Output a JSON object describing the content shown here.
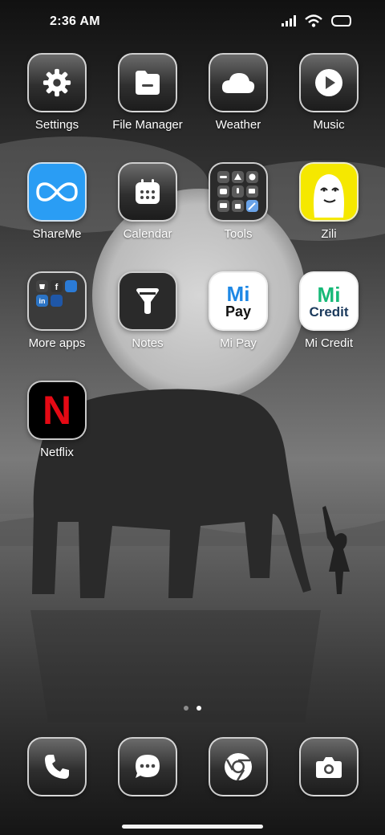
{
  "status_bar": {
    "time": "2:36 AM",
    "icons": [
      "signal-icon",
      "wifi-icon",
      "battery-icon"
    ]
  },
  "apps": [
    {
      "label": "Settings",
      "icon": "gear-icon"
    },
    {
      "label": "File Manager",
      "icon": "folder-icon"
    },
    {
      "label": "Weather",
      "icon": "cloud-icon"
    },
    {
      "label": "Music",
      "icon": "play-icon"
    },
    {
      "label": "ShareMe",
      "icon": "infinity-icon",
      "color": "#2196f3"
    },
    {
      "label": "Calendar",
      "icon": "calendar-icon"
    },
    {
      "label": "Tools",
      "icon": "tools-folder-icon"
    },
    {
      "label": "Zili",
      "icon": "zili-face-icon",
      "color": "#f5e800"
    },
    {
      "label": "More apps",
      "icon": "apps-folder-icon"
    },
    {
      "label": "Notes",
      "icon": "notes-icon"
    },
    {
      "label": "Mi Pay",
      "icon": "mi-pay-icon",
      "logo_text": [
        "Mi",
        "Pay"
      ],
      "color": "#1e88e5"
    },
    {
      "label": "Mi Credit",
      "icon": "mi-credit-icon",
      "logo_text": [
        "Mi",
        "Credit"
      ],
      "color": "#17b978"
    },
    {
      "label": "Netflix",
      "icon": "netflix-icon",
      "logo_text": [
        "N"
      ],
      "color": "#e50914"
    }
  ],
  "folder_previews": {
    "more_apps": [
      "shopping-icon",
      "facebook-icon",
      "prime-video-icon",
      "linkedin-icon",
      "booking-icon"
    ]
  },
  "pager": {
    "pages": 2,
    "active": 2
  },
  "dock": [
    {
      "label": "Phone",
      "icon": "phone-icon"
    },
    {
      "label": "Messages",
      "icon": "message-icon"
    },
    {
      "label": "Chrome",
      "icon": "chrome-icon"
    },
    {
      "label": "Camera",
      "icon": "camera-icon"
    }
  ]
}
